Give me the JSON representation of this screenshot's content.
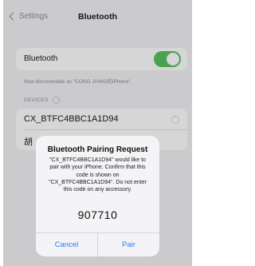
{
  "nav": {
    "back_label": "Settings",
    "title": "Bluetooth"
  },
  "bluetooth": {
    "label": "Bluetooth",
    "enabled": true
  },
  "discoverable_text": "Now discoverable as \"CONG JIANG的iPhone\".",
  "devices_header": "DEVICES",
  "devices": [
    {
      "name": "CX_BTFC4BBC1A1D94"
    },
    {
      "name": "胡"
    }
  ],
  "dialog": {
    "title": "Bluetooth Pairing Request",
    "message_lines": [
      "\"CX_BTFC4BBC1A1D94\" would like to",
      "pair with your iPhone. Confirm that this",
      "code is shown on",
      "\"CX_BTFC4BBC1A1D94\". Do not enter",
      "this code on any accessory."
    ],
    "code": "907710",
    "cancel_label": "Cancel",
    "pair_label": "Pair"
  },
  "colors": {
    "accent": "#2f7cf6",
    "toggle_on": "#58c15f",
    "background": "#f2f2f6"
  }
}
